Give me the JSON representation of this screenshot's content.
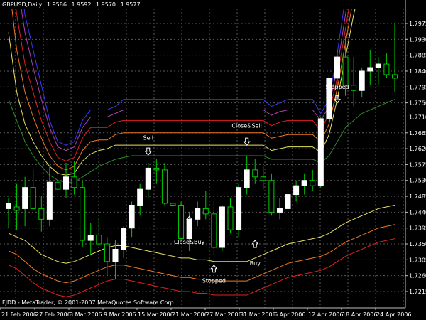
{
  "header": {
    "symbol": "GBPUSD,Daily",
    "ohlc": [
      "1.9586",
      "1.9592",
      "1.9570",
      "1.9577"
    ]
  },
  "footer": {
    "copyright": "FJDD - MetaTrader, © 2001-2007 MetaQuotes Software Corp."
  },
  "colors": {
    "background": "#000000",
    "bull_candle": "#ffffff",
    "bear_candle": "#000000",
    "wick": "#00cc00",
    "band_blue": "#3a3aff",
    "band_purple": "#b040b0",
    "band_red": "#e02020",
    "band_orange": "#f07820",
    "band_yellow": "#e8e060",
    "band_green": "#2e8b2e"
  },
  "chart_data": {
    "type": "candlestick",
    "ylim": [
      1.7215,
      1.7975
    ],
    "y_ticks": [
      "1.7975",
      "1.7930",
      "1.7885",
      "1.7840",
      "1.7795",
      "1.7750",
      "1.7710",
      "1.7665",
      "1.7620",
      "1.7575",
      "1.7530",
      "1.7485",
      "1.7440",
      "1.7395",
      "1.7350",
      "1.7305",
      "1.7260",
      "1.7215"
    ],
    "x_labels": [
      "21 Feb 2006",
      "27 Feb 2006",
      "3 Mar 2006",
      "9 Mar 2006",
      "15 Mar 2006",
      "21 Mar 2006",
      "27 Mar 2006",
      "31 Mar 2006",
      "6 Apr 2006",
      "12 Apr 2006",
      "18 Apr 2006",
      "24 Apr 2006"
    ],
    "candles": [
      {
        "date": "21 Feb 2006",
        "o": 1.745,
        "h": 1.748,
        "l": 1.7395,
        "c": 1.7465
      },
      {
        "date": "22 Feb 2006",
        "o": 1.7455,
        "h": 1.752,
        "l": 1.739,
        "c": 1.7445
      },
      {
        "date": "23 Feb 2006",
        "o": 1.745,
        "h": 1.754,
        "l": 1.74,
        "c": 1.751
      },
      {
        "date": "24 Feb 2006",
        "o": 1.751,
        "h": 1.756,
        "l": 1.745,
        "c": 1.745
      },
      {
        "date": "27 Feb 2006",
        "o": 1.745,
        "h": 1.7485,
        "l": 1.7385,
        "c": 1.742
      },
      {
        "date": "28 Feb 2006",
        "o": 1.742,
        "h": 1.757,
        "l": 1.74,
        "c": 1.7525
      },
      {
        "date": "1 Mar 2006",
        "o": 1.7525,
        "h": 1.7575,
        "l": 1.749,
        "c": 1.7505
      },
      {
        "date": "2 Mar 2006",
        "o": 1.7505,
        "h": 1.758,
        "l": 1.748,
        "c": 1.754
      },
      {
        "date": "3 Mar 2006",
        "o": 1.754,
        "h": 1.7585,
        "l": 1.749,
        "c": 1.751
      },
      {
        "date": "6 Mar 2006",
        "o": 1.751,
        "h": 1.753,
        "l": 1.734,
        "c": 1.736
      },
      {
        "date": "7 Mar 2006",
        "o": 1.736,
        "h": 1.741,
        "l": 1.732,
        "c": 1.7375
      },
      {
        "date": "8 Mar 2006",
        "o": 1.7375,
        "h": 1.742,
        "l": 1.7345,
        "c": 1.735
      },
      {
        "date": "9 Mar 2006",
        "o": 1.735,
        "h": 1.737,
        "l": 1.726,
        "c": 1.73
      },
      {
        "date": "10 Mar 2006",
        "o": 1.73,
        "h": 1.736,
        "l": 1.725,
        "c": 1.7335
      },
      {
        "date": "13 Mar 2006",
        "o": 1.7335,
        "h": 1.74,
        "l": 1.731,
        "c": 1.7395
      },
      {
        "date": "14 Mar 2006",
        "o": 1.7395,
        "h": 1.747,
        "l": 1.737,
        "c": 1.746
      },
      {
        "date": "15 Mar 2006",
        "o": 1.746,
        "h": 1.752,
        "l": 1.743,
        "c": 1.7505
      },
      {
        "date": "16 Mar 2006",
        "o": 1.7505,
        "h": 1.758,
        "l": 1.748,
        "c": 1.7565
      },
      {
        "date": "17 Mar 2006",
        "o": 1.7565,
        "h": 1.759,
        "l": 1.752,
        "c": 1.756
      },
      {
        "date": "20 Mar 2006",
        "o": 1.756,
        "h": 1.758,
        "l": 1.746,
        "c": 1.7465
      },
      {
        "date": "21 Mar 2006",
        "o": 1.7465,
        "h": 1.749,
        "l": 1.744,
        "c": 1.746
      },
      {
        "date": "22 Mar 2006",
        "o": 1.746,
        "h": 1.747,
        "l": 1.736,
        "c": 1.7365
      },
      {
        "date": "23 Mar 2006",
        "o": 1.7365,
        "h": 1.744,
        "l": 1.733,
        "c": 1.742
      },
      {
        "date": "24 Mar 2006",
        "o": 1.742,
        "h": 1.747,
        "l": 1.74,
        "c": 1.745
      },
      {
        "date": "27 Mar 2006",
        "o": 1.745,
        "h": 1.75,
        "l": 1.742,
        "c": 1.7435
      },
      {
        "date": "28 Mar 2006",
        "o": 1.7435,
        "h": 1.747,
        "l": 1.732,
        "c": 1.734
      },
      {
        "date": "29 Mar 2006",
        "o": 1.734,
        "h": 1.746,
        "l": 1.733,
        "c": 1.7455
      },
      {
        "date": "30 Mar 2006",
        "o": 1.7455,
        "h": 1.748,
        "l": 1.738,
        "c": 1.739
      },
      {
        "date": "31 Mar 2006",
        "o": 1.739,
        "h": 1.752,
        "l": 1.737,
        "c": 1.751
      },
      {
        "date": "3 Apr 2006",
        "o": 1.751,
        "h": 1.76,
        "l": 1.749,
        "c": 1.756
      },
      {
        "date": "4 Apr 2006",
        "o": 1.756,
        "h": 1.759,
        "l": 1.752,
        "c": 1.754
      },
      {
        "date": "5 Apr 2006",
        "o": 1.754,
        "h": 1.757,
        "l": 1.7505,
        "c": 1.753
      },
      {
        "date": "6 Apr 2006",
        "o": 1.753,
        "h": 1.755,
        "l": 1.743,
        "c": 1.744
      },
      {
        "date": "7 Apr 2006",
        "o": 1.744,
        "h": 1.748,
        "l": 1.742,
        "c": 1.745
      },
      {
        "date": "10 Apr 2006",
        "o": 1.745,
        "h": 1.75,
        "l": 1.7425,
        "c": 1.749
      },
      {
        "date": "11 Apr 2006",
        "o": 1.749,
        "h": 1.753,
        "l": 1.747,
        "c": 1.7515
      },
      {
        "date": "12 Apr 2006",
        "o": 1.7515,
        "h": 1.755,
        "l": 1.749,
        "c": 1.753
      },
      {
        "date": "13 Apr 2006",
        "o": 1.753,
        "h": 1.756,
        "l": 1.75,
        "c": 1.7515
      },
      {
        "date": "14 Apr 2006",
        "o": 1.7515,
        "h": 1.771,
        "l": 1.751,
        "c": 1.7705
      },
      {
        "date": "17 Apr 2006",
        "o": 1.7705,
        "h": 1.783,
        "l": 1.769,
        "c": 1.782
      },
      {
        "date": "18 Apr 2006",
        "o": 1.782,
        "h": 1.79,
        "l": 1.78,
        "c": 1.788
      },
      {
        "date": "19 Apr 2006",
        "o": 1.788,
        "h": 1.794,
        "l": 1.777,
        "c": 1.78
      },
      {
        "date": "20 Apr 2006",
        "o": 1.78,
        "h": 1.788,
        "l": 1.774,
        "c": 1.7785
      },
      {
        "date": "21 Apr 2006",
        "o": 1.7785,
        "h": 1.785,
        "l": 1.7765,
        "c": 1.784
      },
      {
        "date": "24 Apr 2006",
        "o": 1.784,
        "h": 1.79,
        "l": 1.78,
        "c": 1.785
      },
      {
        "date": "25 Apr 2006",
        "o": 1.785,
        "h": 1.788,
        "l": 1.78,
        "c": 1.786
      },
      {
        "date": "26 Apr 2006",
        "o": 1.786,
        "h": 1.789,
        "l": 1.782,
        "c": 1.783
      },
      {
        "date": "27 Apr 2006",
        "o": 1.783,
        "h": 1.7975,
        "l": 1.778,
        "c": 1.782
      }
    ],
    "bands": [
      {
        "color_key": "band_blue",
        "values": [
          1.84,
          1.82,
          1.8,
          1.79,
          1.78,
          1.77,
          1.764,
          1.763,
          1.764,
          1.77,
          1.773,
          1.773,
          1.773,
          1.774,
          1.776,
          1.776,
          1.776,
          1.776,
          1.776,
          1.776,
          1.776,
          1.776,
          1.776,
          1.776,
          1.776,
          1.776,
          1.776,
          1.776,
          1.776,
          1.776,
          1.776,
          1.776,
          1.774,
          1.775,
          1.776,
          1.776,
          1.776,
          1.776,
          1.772,
          1.776,
          1.789,
          1.805,
          1.82,
          1.83,
          1.84,
          1.85,
          1.86,
          1.87
        ]
      },
      {
        "color_key": "band_purple",
        "values": [
          1.83,
          1.81,
          1.795,
          1.785,
          1.776,
          1.768,
          1.7625,
          1.7615,
          1.7625,
          1.768,
          1.771,
          1.771,
          1.771,
          1.772,
          1.773,
          1.773,
          1.773,
          1.773,
          1.773,
          1.773,
          1.773,
          1.773,
          1.773,
          1.773,
          1.773,
          1.773,
          1.773,
          1.773,
          1.773,
          1.773,
          1.773,
          1.773,
          1.7715,
          1.7725,
          1.773,
          1.773,
          1.773,
          1.773,
          1.77,
          1.774,
          1.785,
          1.8,
          1.815,
          1.825,
          1.835,
          1.845,
          1.855,
          1.865
        ]
      },
      {
        "color_key": "band_red",
        "values": [
          1.82,
          1.8,
          1.786,
          1.778,
          1.77,
          1.764,
          1.7595,
          1.7585,
          1.7595,
          1.765,
          1.768,
          1.768,
          1.768,
          1.7695,
          1.77,
          1.77,
          1.77,
          1.77,
          1.77,
          1.77,
          1.77,
          1.77,
          1.77,
          1.77,
          1.77,
          1.77,
          1.77,
          1.77,
          1.77,
          1.77,
          1.77,
          1.77,
          1.7685,
          1.7695,
          1.77,
          1.77,
          1.77,
          1.77,
          1.767,
          1.772,
          1.782,
          1.796,
          1.81,
          1.82,
          1.83,
          1.84,
          1.85,
          1.86
        ]
      },
      {
        "color_key": "band_orange",
        "values": [
          1.81,
          1.79,
          1.778,
          1.771,
          1.765,
          1.76,
          1.757,
          1.756,
          1.757,
          1.7615,
          1.764,
          1.7645,
          1.7645,
          1.766,
          1.7665,
          1.7665,
          1.7665,
          1.7665,
          1.7665,
          1.7665,
          1.7665,
          1.7665,
          1.7665,
          1.7665,
          1.7665,
          1.7665,
          1.7665,
          1.7665,
          1.7665,
          1.7665,
          1.7665,
          1.7665,
          1.765,
          1.7655,
          1.766,
          1.766,
          1.766,
          1.766,
          1.764,
          1.769,
          1.779,
          1.792,
          1.805,
          1.815,
          1.825,
          1.835,
          1.845,
          1.855
        ]
      },
      {
        "color_key": "band_yellow",
        "values": [
          1.795,
          1.778,
          1.769,
          1.764,
          1.76,
          1.757,
          1.755,
          1.7545,
          1.755,
          1.7585,
          1.7605,
          1.7615,
          1.762,
          1.763,
          1.763,
          1.763,
          1.763,
          1.763,
          1.763,
          1.763,
          1.763,
          1.763,
          1.763,
          1.763,
          1.763,
          1.763,
          1.763,
          1.763,
          1.763,
          1.763,
          1.763,
          1.763,
          1.7615,
          1.762,
          1.7625,
          1.7625,
          1.7625,
          1.7625,
          1.761,
          1.766,
          1.776,
          1.788,
          1.8,
          1.81,
          1.82,
          1.83,
          1.84,
          1.85
        ]
      },
      {
        "color_key": "band_green",
        "values": [
          1.776,
          1.77,
          1.764,
          1.76,
          1.757,
          1.7545,
          1.753,
          1.7525,
          1.7525,
          1.754,
          1.7555,
          1.757,
          1.758,
          1.759,
          1.7595,
          1.76,
          1.76,
          1.76,
          1.76,
          1.76,
          1.76,
          1.76,
          1.76,
          1.76,
          1.76,
          1.76,
          1.76,
          1.76,
          1.76,
          1.76,
          1.76,
          1.76,
          1.759,
          1.759,
          1.759,
          1.759,
          1.759,
          1.759,
          1.758,
          1.76,
          1.764,
          1.768,
          1.77,
          1.772,
          1.773,
          1.774,
          1.775,
          1.776
        ]
      },
      {
        "color_key": "band_yellow",
        "values": [
          1.738,
          1.737,
          1.736,
          1.734,
          1.732,
          1.731,
          1.73,
          1.7295,
          1.73,
          1.731,
          1.732,
          1.733,
          1.734,
          1.7345,
          1.7345,
          1.734,
          1.7335,
          1.733,
          1.7325,
          1.732,
          1.7315,
          1.731,
          1.731,
          1.7305,
          1.7305,
          1.73,
          1.73,
          1.73,
          1.73,
          1.73,
          1.731,
          1.732,
          1.733,
          1.734,
          1.735,
          1.7355,
          1.736,
          1.7365,
          1.737,
          1.738,
          1.7395,
          1.741,
          1.742,
          1.743,
          1.744,
          1.745,
          1.7455,
          1.746
        ]
      },
      {
        "color_key": "band_orange",
        "values": [
          1.733,
          1.732,
          1.73,
          1.728,
          1.7265,
          1.7255,
          1.7245,
          1.724,
          1.7245,
          1.7255,
          1.7265,
          1.7275,
          1.7285,
          1.729,
          1.729,
          1.7285,
          1.728,
          1.7275,
          1.727,
          1.7265,
          1.726,
          1.7255,
          1.7255,
          1.725,
          1.725,
          1.7245,
          1.7245,
          1.7245,
          1.7245,
          1.7245,
          1.7255,
          1.7265,
          1.7275,
          1.7285,
          1.7295,
          1.73,
          1.7305,
          1.731,
          1.7315,
          1.7325,
          1.734,
          1.7355,
          1.7365,
          1.7375,
          1.7385,
          1.7395,
          1.74,
          1.7405
        ]
      },
      {
        "color_key": "band_red",
        "values": [
          1.729,
          1.728,
          1.726,
          1.724,
          1.7225,
          1.7215,
          1.7205,
          1.72,
          1.7205,
          1.7215,
          1.7225,
          1.7235,
          1.7245,
          1.725,
          1.725,
          1.7245,
          1.724,
          1.7235,
          1.723,
          1.7225,
          1.722,
          1.7215,
          1.7215,
          1.721,
          1.721,
          1.7205,
          1.7205,
          1.7205,
          1.7205,
          1.7205,
          1.7215,
          1.7225,
          1.7235,
          1.7245,
          1.7255,
          1.726,
          1.7265,
          1.727,
          1.7275,
          1.7285,
          1.73,
          1.7315,
          1.7325,
          1.7335,
          1.7345,
          1.7355,
          1.736,
          1.7365
        ]
      }
    ],
    "annotations": [
      {
        "text": "Sell",
        "candle": "16 Mar 2006",
        "price": 1.7645,
        "arrow": "down",
        "arrow_price": 1.7612
      },
      {
        "text": "Close&Sell",
        "candle": "3 Apr 2006",
        "price": 1.768,
        "arrow": "down",
        "arrow_price": 1.764
      },
      {
        "text": "Stopped",
        "candle": "18 Apr 2006",
        "price": 1.779,
        "arrow": "down",
        "arrow_price": 1.776
      },
      {
        "text": "Close&Buy",
        "candle": "23 Mar 2006",
        "price": 1.735,
        "arrow": "up",
        "arrow_price": 1.7418
      },
      {
        "text": "Buy",
        "candle": "4 Apr 2006",
        "price": 1.729,
        "arrow": "up",
        "arrow_price": 1.735
      },
      {
        "text": "Stopped",
        "candle": "28 Mar 2006",
        "price": 1.724,
        "arrow": "up",
        "arrow_price": 1.728
      }
    ]
  }
}
